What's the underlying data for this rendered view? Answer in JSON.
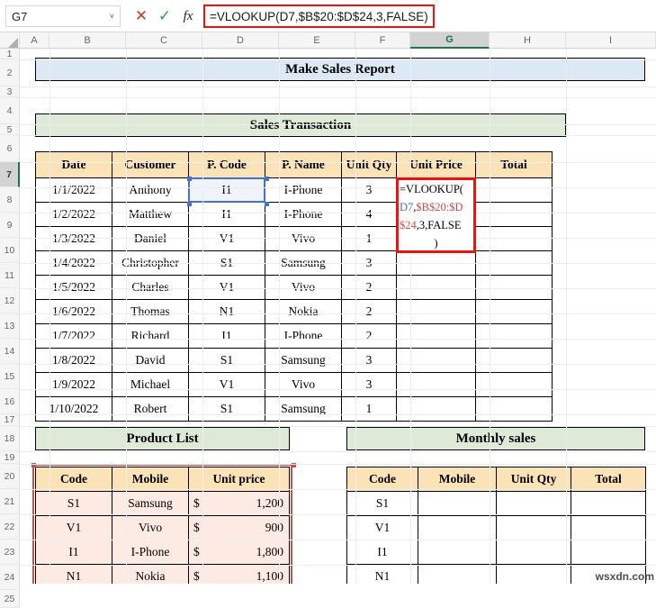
{
  "formula_bar": {
    "name_box_value": "G7",
    "name_box_caret": "˅",
    "cancel_icon": "✕",
    "enter_icon": "✓",
    "fx_icon": "fx",
    "formula": "=VLOOKUP(D7,$B$20:$D$24,3,FALSE)",
    "formula_border_color": "#e81414"
  },
  "grid": {
    "columns": [
      "A",
      "B",
      "C",
      "D",
      "E",
      "F",
      "G",
      "H",
      "I"
    ],
    "selected_column": "G",
    "rows": [
      "1",
      "2",
      "3",
      "4",
      "5",
      "6",
      "7",
      "8",
      "9",
      "10",
      "11",
      "12",
      "13",
      "14",
      "15",
      "16",
      "17",
      "18",
      "19",
      "20",
      "21",
      "22",
      "23",
      "24",
      "25"
    ],
    "selected_row": "7"
  },
  "banners": {
    "report_title": "Make Sales Report",
    "report_title_bg": "#dce9f5",
    "transaction_title": "Sales Transaction",
    "transaction_title_bg": "#dee9d7",
    "product_list_title": "Product List",
    "product_list_title_bg": "#dee9d7",
    "monthly_sales_title": "Monthly sales",
    "monthly_sales_title_bg": "#dee9d7"
  },
  "sales_table": {
    "header_bg": "#fbe2b7",
    "headers": [
      "Date",
      "Customer",
      "P. Code",
      "P. Name",
      "Unit Qty",
      "Unit Price",
      "Total"
    ],
    "rows": [
      {
        "date": "1/1/2022",
        "customer": "Anthony",
        "pcode": "I1",
        "pname": "I-Phone",
        "qty": "3",
        "price": "",
        "total": ""
      },
      {
        "date": "1/2/2022",
        "customer": "Matthew",
        "pcode": "I1",
        "pname": "I-Phone",
        "qty": "4",
        "price": "",
        "total": ""
      },
      {
        "date": "1/3/2022",
        "customer": "Daniel",
        "pcode": "V1",
        "pname": "Vivo",
        "qty": "1",
        "price": "",
        "total": ""
      },
      {
        "date": "1/4/2022",
        "customer": "Christopher",
        "pcode": "S1",
        "pname": "Samsung",
        "qty": "3",
        "price": "",
        "total": ""
      },
      {
        "date": "1/5/2022",
        "customer": "Charles",
        "pcode": "V1",
        "pname": "Vivo",
        "qty": "2",
        "price": "",
        "total": ""
      },
      {
        "date": "1/6/2022",
        "customer": "Thomas",
        "pcode": "N1",
        "pname": "Nokia",
        "qty": "2",
        "price": "",
        "total": ""
      },
      {
        "date": "1/7/2022",
        "customer": "Richard",
        "pcode": "I1",
        "pname": "I-Phone",
        "qty": "2",
        "price": "",
        "total": ""
      },
      {
        "date": "1/8/2022",
        "customer": "David",
        "pcode": "S1",
        "pname": "Samsung",
        "qty": "3",
        "price": "",
        "total": ""
      },
      {
        "date": "1/9/2022",
        "customer": "Michael",
        "pcode": "V1",
        "pname": "Vivo",
        "qty": "3",
        "price": "",
        "total": ""
      },
      {
        "date": "1/10/2022",
        "customer": "Robert",
        "pcode": "S1",
        "pname": "Samsung",
        "qty": "1",
        "price": "",
        "total": ""
      }
    ]
  },
  "editing_cell": {
    "address": "G7",
    "border_color": "#e81414",
    "segments": [
      {
        "text": "=VLOOKUP(",
        "color": "#000000"
      },
      {
        "text": "D7",
        "color": "#4472c4"
      },
      {
        "text": ",",
        "color": "#000000"
      },
      {
        "text": "$B$20:$D$24",
        "color": "#c0504d"
      },
      {
        "text": ",3,FALSE",
        "color": "#000000"
      },
      {
        "text": ")",
        "color": "#000000"
      }
    ],
    "lines": [
      "=VLOOKUP(",
      "D7,$B$20:$D",
      "$24,3,FALSE",
      ")"
    ]
  },
  "reference_d7": {
    "address": "D7",
    "value": "I1",
    "border_color": "#4472c4",
    "fill": "#eef3fb"
  },
  "product_list": {
    "range": "$B$20:$D$24",
    "header_bg": "#fbe2b7",
    "body_bg": "#fdeae3",
    "border_color": "#c0504d",
    "headers": [
      "Code",
      "Mobile",
      "Unit price"
    ],
    "rows": [
      {
        "code": "S1",
        "mobile": "Samsung",
        "currency": "$",
        "price": "1,200"
      },
      {
        "code": "V1",
        "mobile": "Vivo",
        "currency": "$",
        "price": "900"
      },
      {
        "code": "I1",
        "mobile": "I-Phone",
        "currency": "$",
        "price": "1,800"
      },
      {
        "code": "N1",
        "mobile": "Nokia",
        "currency": "$",
        "price": "1,100"
      }
    ]
  },
  "monthly_sales": {
    "header_bg": "#fbe2b7",
    "headers": [
      "Code",
      "Mobile",
      "Unit Qty",
      "Total"
    ],
    "rows": [
      {
        "code": "S1",
        "mobile": "",
        "qty": "",
        "total": ""
      },
      {
        "code": "V1",
        "mobile": "",
        "qty": "",
        "total": ""
      },
      {
        "code": "I1",
        "mobile": "",
        "qty": "",
        "total": ""
      },
      {
        "code": "N1",
        "mobile": "",
        "qty": "",
        "total": ""
      }
    ]
  },
  "watermark": "wsxdn.com"
}
